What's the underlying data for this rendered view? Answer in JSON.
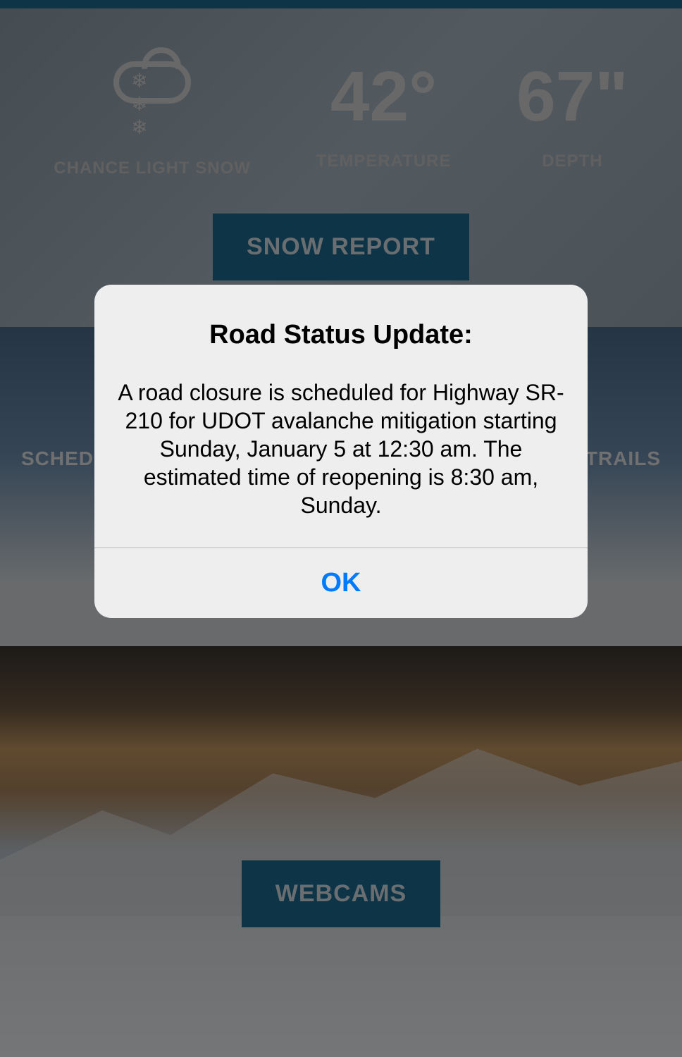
{
  "topBar": {},
  "weather": {
    "conditionLabel": "CHANCE LIGHT SNOW",
    "temperature": "42°",
    "temperatureLabel": "TEMPERATURE",
    "depth": "67\"",
    "depthLabel": "DEPTH"
  },
  "buttons": {
    "snowReport": "SNOW REPORT",
    "webcams": "WEBCAMS"
  },
  "stats": {
    "leftLabel": "SCHED",
    "rightLabel": "TRAILS"
  },
  "dialog": {
    "title": "Road Status Update:",
    "body": "A road closure is scheduled for Highway SR-210 for UDOT avalanche mitigation starting Sunday, January 5 at 12:30 am. The estimated time of reopening is 8:30 am, Sunday.",
    "okLabel": "OK"
  }
}
